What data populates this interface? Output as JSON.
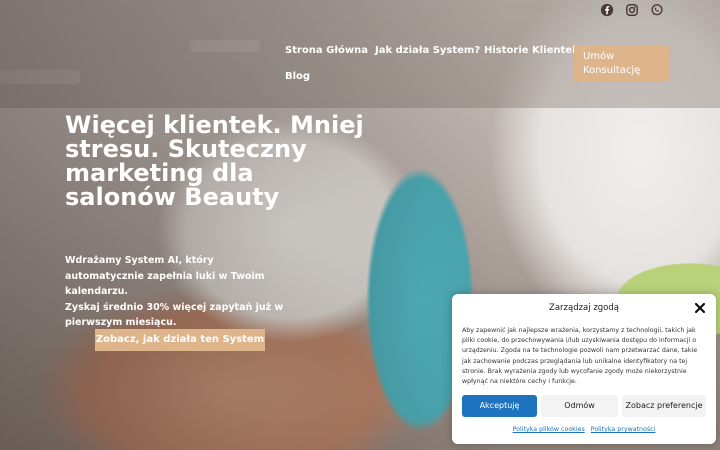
{
  "social": {
    "icons": [
      "facebook-icon",
      "instagram-icon",
      "whatsapp-icon"
    ],
    "icon_color": "#5a4a44"
  },
  "nav": {
    "items": [
      "Strona Główna",
      "Jak działa System?",
      "Historie Klientek",
      "Blog"
    ],
    "cta_label": "Umów Konsultację"
  },
  "hero": {
    "headline": "Więcej klientek. Mniej stresu. Skuteczny marketing dla salonów Beauty",
    "sub_line1": "Wdrażamy System AI, który automatycznie zapełnia luki w Twoim kalendarzu.",
    "sub_line2": "Zyskaj średnio 30% więcej zapytań już w pierwszym miesiącu.",
    "cta_label": "Zobacz, jak działa ten System"
  },
  "consent": {
    "title": "Zarządzaj zgodą",
    "body": "Aby zapewnić jak najlepsze wrażenia, korzystamy z technologii, takich jak pliki cookie, do przechowywania i/lub uzyskiwania dostępu do informacji o urządzeniu. Zgoda na te technologie pozwoli nam przetwarzać dane, takie jak zachowanie podczas przeglądania lub unikalne identyfikatory na tej stronie. Brak wyrażenia zgody lub wycofanie zgody może niekorzystnie wpłynąć na niektóre cechy i funkcje.",
    "accept_label": "Akceptuję",
    "deny_label": "Odmów",
    "prefs_label": "Zobacz preferencje",
    "link_cookies": "Polityka plików cookies",
    "link_privacy": "Polityka prywatności"
  },
  "colors": {
    "accent": "#deb48b",
    "accept_button": "#1e73be"
  }
}
